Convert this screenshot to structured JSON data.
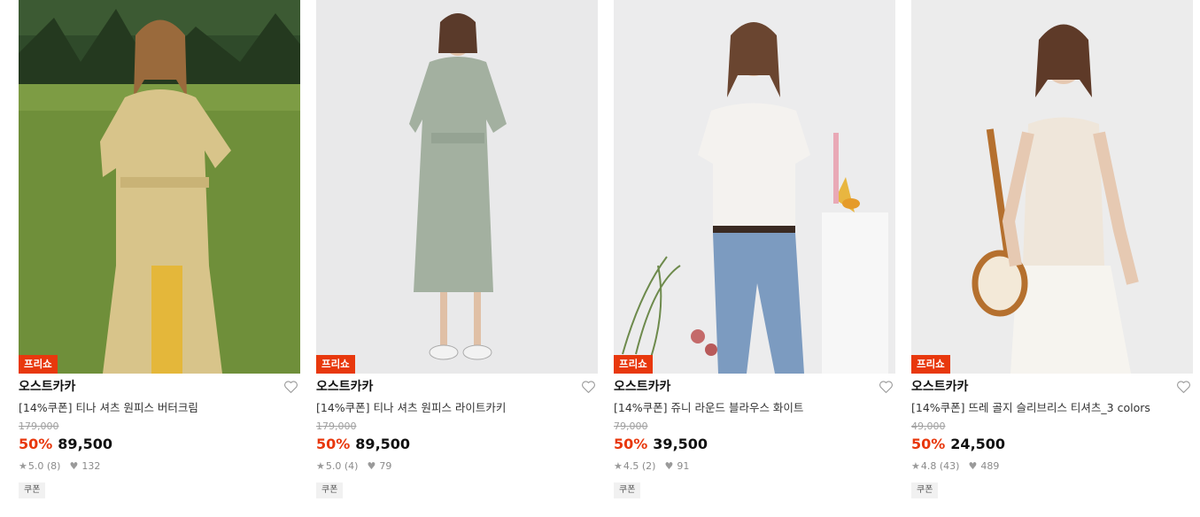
{
  "products": [
    {
      "badge": "프리쇼",
      "brand": "오스트카카",
      "title": "[14%쿠폰] 티나 셔츠 원피스 버터크림",
      "original_price": "179,000",
      "discount": "50%",
      "price": "89,500",
      "rating": "5.0 (8)",
      "likes": "132",
      "tag": "쿠폰"
    },
    {
      "badge": "프리쇼",
      "brand": "오스트카카",
      "title": "[14%쿠폰] 티나 셔츠 원피스 라이트카키",
      "original_price": "179,000",
      "discount": "50%",
      "price": "89,500",
      "rating": "5.0 (4)",
      "likes": "79",
      "tag": "쿠폰"
    },
    {
      "badge": "프리쇼",
      "brand": "오스트카카",
      "title": "[14%쿠폰] 쥬니 라운드 블라우스 화이트",
      "original_price": "79,000",
      "discount": "50%",
      "price": "39,500",
      "rating": "4.5 (2)",
      "likes": "91",
      "tag": "쿠폰"
    },
    {
      "badge": "프리쇼",
      "brand": "오스트카카",
      "title": "[14%쿠폰] 뜨레 골지 슬리브리스 티셔츠_3 colors",
      "original_price": "49,000",
      "discount": "50%",
      "price": "24,500",
      "rating": "4.8 (43)",
      "likes": "489",
      "tag": "쿠폰"
    }
  ],
  "colors": {
    "accent": "#e8380d",
    "muted": "#a0a0a0"
  },
  "icons": {
    "wishlist": "heart-outline-icon",
    "rating": "star-icon",
    "likes": "heart-filled-icon"
  }
}
